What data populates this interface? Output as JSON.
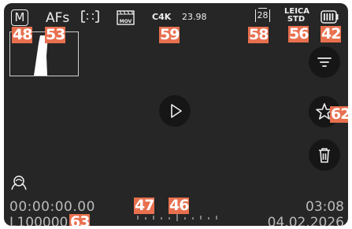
{
  "status_bar": {
    "mode": "M",
    "af_mode": "AFs",
    "metering_icon": "metering-icon",
    "file_format": "MOV",
    "resolution": "C4K",
    "frame_rate": "23.98",
    "bracket_count": "28",
    "look_brand": "LEICA",
    "look_profile": "STD",
    "battery_icon": "battery-icon"
  },
  "sidebar": {
    "filter_icon": "filter-icon",
    "favorite_icon": "star-icon",
    "delete_icon": "trash-icon"
  },
  "playback": {
    "play_icon": "play-icon"
  },
  "bottom": {
    "timecode": "00:00:00.00",
    "file_number": "L100000",
    "clip_length": "03:08",
    "date": "04.02.2026",
    "face_icon": "face-detection-icon"
  },
  "callouts": [
    "48",
    "53",
    "59",
    "58",
    "56",
    "42",
    "62",
    "47",
    "46",
    "63"
  ],
  "colors": {
    "screen_bg": "#262626",
    "button_bg": "#161616",
    "callout": "#e8704f"
  }
}
